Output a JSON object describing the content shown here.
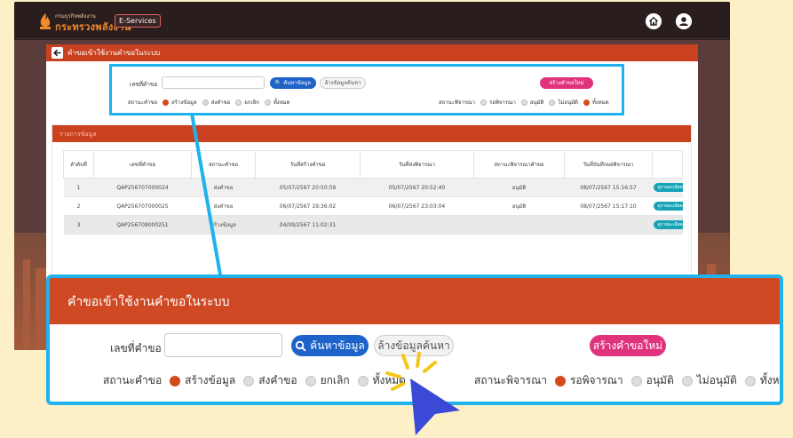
{
  "header": {
    "logo_line1": "กรมธุรกิจพลังงาน",
    "logo_line2": "กระทรวงพลังงาน",
    "eservices": "E-Services",
    "icons": [
      "home-icon",
      "user-icon"
    ]
  },
  "page": {
    "title": "คำขอเข้าใช้งานคำขอในระบบ"
  },
  "search": {
    "request_no_label": "เลขที่คำขอ",
    "request_no_value": "",
    "search_button": "ค้นหาข้อมูล",
    "clear_button": "ล้างข้อมูลค้นหา",
    "new_button": "สร้างคำขอใหม่",
    "status_label": "สถานะคำขอ",
    "status_options": [
      {
        "label": "สร้างข้อมูล",
        "checked": true
      },
      {
        "label": "ส่งคำขอ",
        "checked": false
      },
      {
        "label": "ยกเลิก",
        "checked": false
      },
      {
        "label": "ทั้งหมด",
        "checked": false
      }
    ],
    "review_label": "สถานะพิจารณา",
    "review_options": [
      {
        "label": "รอพิจารณา",
        "checked": true
      },
      {
        "label": "อนุมัติ",
        "checked": false
      },
      {
        "label": "ไม่อนุมัติ",
        "checked": false
      },
      {
        "label": "ทั้งหมด",
        "checked": false
      }
    ],
    "small_status_checked_last": true
  },
  "list": {
    "title": "รายการข้อมูล",
    "columns": [
      "ลำดับที่",
      "เลขที่คำขอ",
      "สถานะคำขอ",
      "วันที่สร้างคำขอ",
      "วันที่ส่งพิจารณา",
      "สถานะพิจารณาคำขอ",
      "วันที่บันทึกผลพิจารณา",
      ""
    ],
    "rows": [
      {
        "no": "1",
        "request_no": "QAP256707000024",
        "status": "ส่งคำขอ",
        "created": "05/07/2567 20:50:59",
        "sent": "05/07/2567 20:52:40",
        "review": "อนุมัติ",
        "reviewed": "08/07/2567 15:16:57",
        "action": "ดูรายละเอียด"
      },
      {
        "no": "2",
        "request_no": "QAP256707000025",
        "status": "ส่งคำขอ",
        "created": "06/07/2567 19:36:02",
        "sent": "06/07/2567 23:03:04",
        "review": "อนุมัติ",
        "reviewed": "08/07/2567 15:17:10",
        "action": "ดูรายละเอียด"
      },
      {
        "no": "3",
        "request_no": "QAP256709000251",
        "status": "สร้างข้อมูล",
        "created": "04/09/2567 11:02:31",
        "sent": "",
        "review": "",
        "reviewed": "",
        "action": "ดูรายละเอียด"
      }
    ]
  },
  "colors": {
    "accent": "#c9411f",
    "highlight": "#1fb2ec",
    "primary": "#1e63c9",
    "pink": "#e0337e",
    "teal": "#17a3b6"
  }
}
